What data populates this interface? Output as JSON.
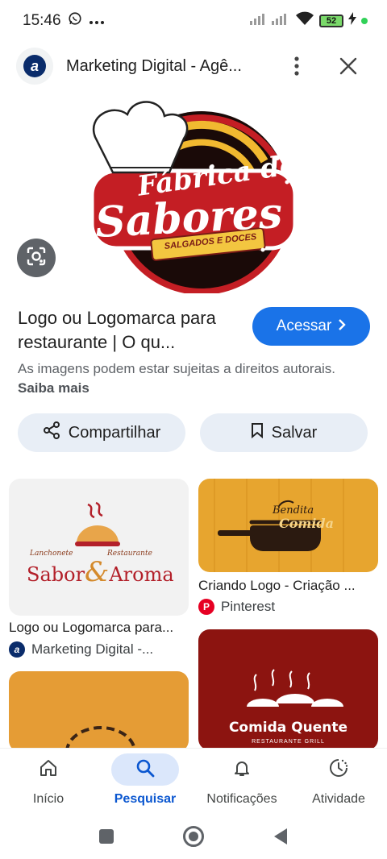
{
  "status_bar": {
    "time": "15:46",
    "battery": "52",
    "icons": [
      "whatsapp-icon",
      "more-dots-icon",
      "signal-icon",
      "wifi-icon",
      "battery-icon",
      "charging-icon"
    ]
  },
  "header": {
    "site_title": "Marketing Digital - Agê...",
    "site_logo_letter": "a"
  },
  "hero": {
    "logo_line1": "Fábrica de",
    "logo_line2": "Sabores",
    "logo_ribbon": "SALGADOS E DOCES"
  },
  "result": {
    "title": "Logo ou Logomarca para restaurante | O qu...",
    "access_label": "Acessar",
    "rights_text": "As imagens podem estar sujeitas a direitos autorais.",
    "rights_link": "Saiba mais"
  },
  "actions": {
    "share_label": "Compartilhar",
    "save_label": "Salvar"
  },
  "grid": {
    "card1": {
      "title": "Logo ou Logomarca para...",
      "source": "Marketing Digital -...",
      "img_small_left": "Lanchonete",
      "img_small_right": "Restaurante",
      "img_main": "Sabor",
      "img_main2": "Aroma"
    },
    "card2": {
      "title": "Criando Logo - Criação ...",
      "source": "Pinterest",
      "img_text1": "Bendita",
      "img_text2": "Comida"
    },
    "card3": {
      "img_text": "Comida Quente",
      "img_sub": "RESTAURANTE GRILL"
    }
  },
  "bottom_nav": {
    "items": [
      {
        "label": "Início",
        "icon": "home-icon"
      },
      {
        "label": "Pesquisar",
        "icon": "search-icon"
      },
      {
        "label": "Notificações",
        "icon": "bell-icon"
      },
      {
        "label": "Atividade",
        "icon": "activity-icon"
      }
    ],
    "active": "Pesquisar"
  },
  "colors": {
    "accent": "#1a73e8",
    "brand_red": "#c41e24",
    "nav_active": "#0b57d0"
  }
}
